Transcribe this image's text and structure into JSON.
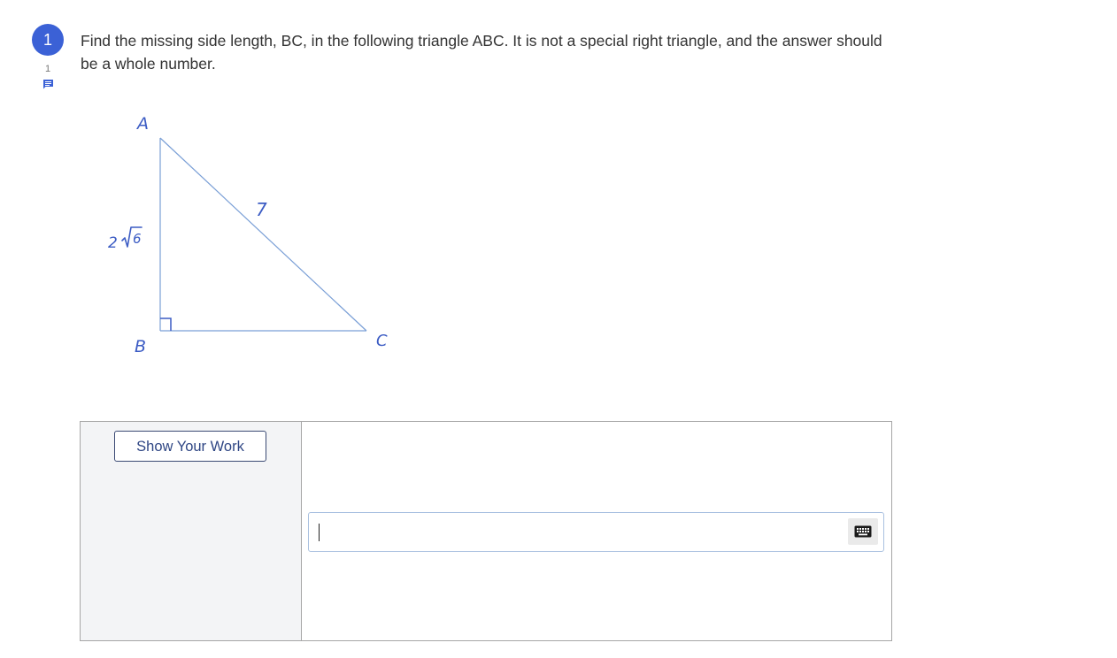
{
  "question": {
    "number": "1",
    "comment_count": "1",
    "prompt": "Find the missing side length, BC, in the following triangle ABC.  It is not a special right triangle, and the answer should be a whole number."
  },
  "figure": {
    "labels": {
      "a": "A",
      "b": "B",
      "c": "C",
      "hypotenuse": "7",
      "leg_ab_coefficient": "2",
      "leg_ab_radicand": "6"
    },
    "stroke_color": "#7a9fd6",
    "label_color": "#3c5cc4"
  },
  "work": {
    "show_work_label": "Show Your Work",
    "answer_value": "",
    "answer_placeholder": ""
  },
  "icons": {
    "comment": "comment-icon",
    "keyboard": "keyboard-icon"
  },
  "colors": {
    "accent": "#3b61d6",
    "button_text": "#2f4684",
    "panel_bg": "#f3f4f6"
  }
}
